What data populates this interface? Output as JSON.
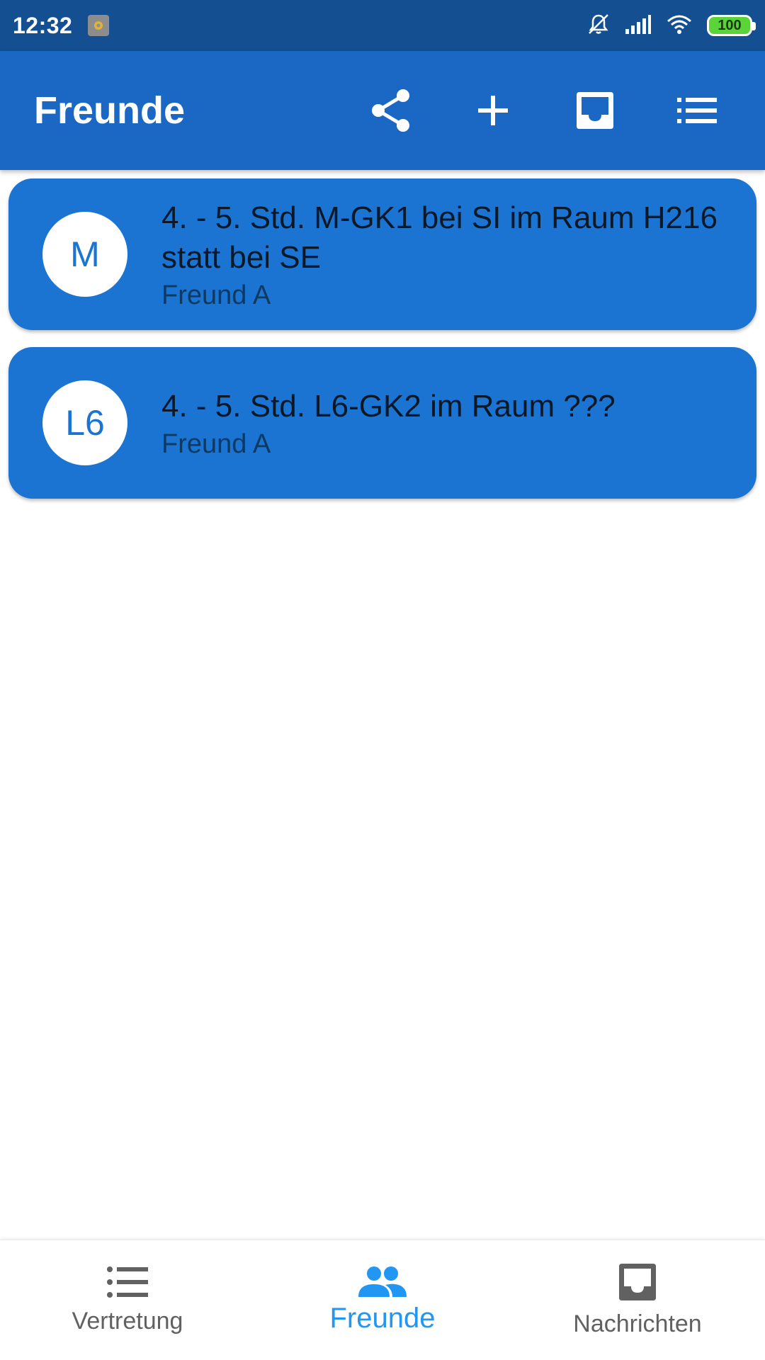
{
  "status_bar": {
    "time": "12:32",
    "battery": "100",
    "icons": [
      "app-notification-icon",
      "mute-icon",
      "signal-icon",
      "wifi-icon",
      "battery-icon"
    ]
  },
  "app_bar": {
    "title": "Freunde",
    "actions": [
      "share-icon",
      "add-icon",
      "inbox-icon",
      "list-icon"
    ]
  },
  "items": [
    {
      "avatar": "M",
      "title": "4. - 5. Std. M-GK1 bei SI im Raum H216  statt bei SE",
      "subtitle": "Freund A"
    },
    {
      "avatar": "L6",
      "title": "4. - 5. Std. L6-GK2 im Raum ???",
      "subtitle": "Freund A"
    }
  ],
  "bottom_nav": {
    "items": [
      {
        "label": "Vertretung",
        "icon": "list-bullets-icon"
      },
      {
        "label": "Freunde",
        "icon": "people-icon"
      },
      {
        "label": "Nachrichten",
        "icon": "inbox-icon"
      }
    ],
    "active_index": 1
  },
  "colors": {
    "status_bar": "#144f92",
    "app_bar": "#1b68c4",
    "card": "#1b74d2",
    "active_nav": "#2196f3",
    "inactive_nav": "#616161"
  }
}
